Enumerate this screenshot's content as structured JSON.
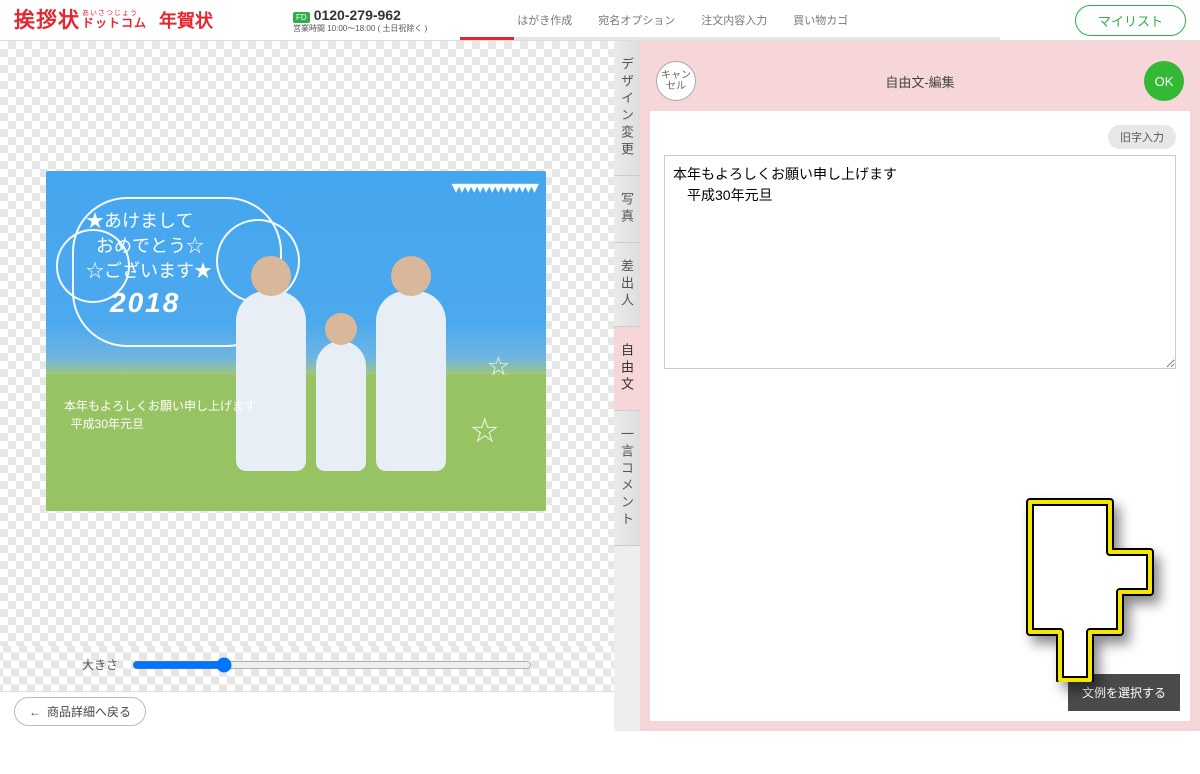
{
  "header": {
    "brand_main": "挨拶状",
    "brand_ruby": "あいさつじょう",
    "brand_sub": "ドットコム",
    "brand_card": "年賀状",
    "freedial": "FD",
    "tel": "0120-279-962",
    "hours": "営業時間 10:00～18:00 ( 土日祝除く )",
    "mylist": "マイリスト"
  },
  "steps": [
    "はがき作成",
    "宛名オプション",
    "注文内容入力",
    "買い物カゴ"
  ],
  "preview": {
    "greeting_l1": "あけまして",
    "greeting_l2": "おめでとう",
    "greeting_l3": "ございます",
    "year": "2018",
    "overlay_l1": "本年もよろしくお願い申し上げます",
    "overlay_l2": "平成30年元旦"
  },
  "size_label": "大きさ",
  "back_btn": "商品詳細へ戻る",
  "tabs": [
    "デザイン変更",
    "写真",
    "差出人",
    "自由文",
    "一言コメント"
  ],
  "active_tab": 3,
  "editor": {
    "cancel": "キャンセル",
    "title": "自由文-編集",
    "ok": "OK",
    "old_input": "旧字入力",
    "textarea": "本年もよろしくお願い申し上げます\n　平成30年元旦",
    "select_example": "文例を選択する"
  }
}
